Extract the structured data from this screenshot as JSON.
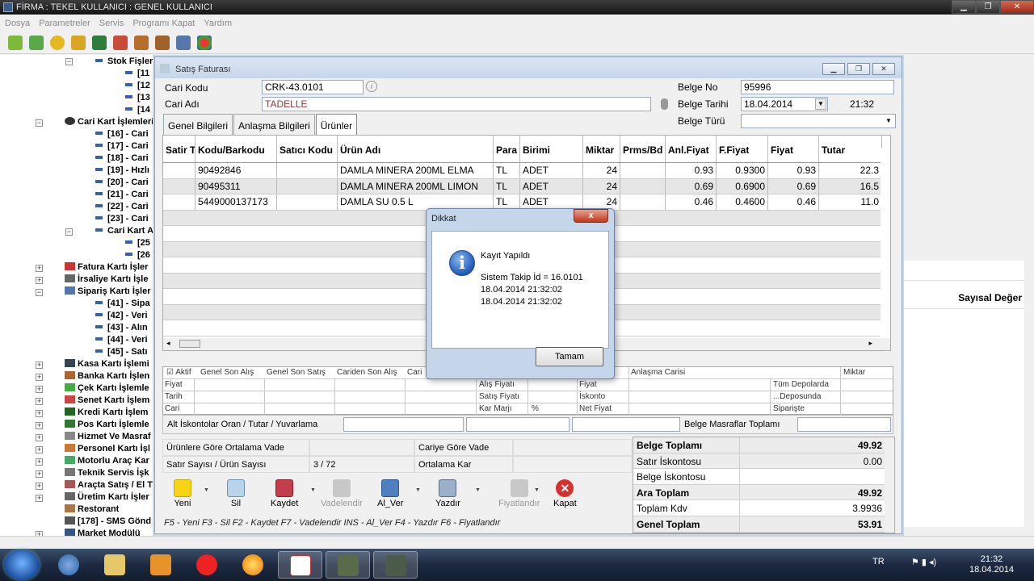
{
  "app_title": "FİRMA : TEKEL   KULLANICI : GENEL KULLANICI",
  "menu": [
    "Dosya",
    "Parametreler",
    "Servis",
    "Programı Kapat",
    "Yardım"
  ],
  "tree": {
    "stok_fisleri": "Stok Fişleri",
    "stok_children": [
      "[11",
      "[12",
      "[13",
      "[14"
    ],
    "cari_kart_islemleri": "Cari Kart İşlemleri",
    "cari_children": [
      "[16] - Cari",
      "[17] - Cari",
      "[18] - Cari",
      "[19] - Hızlı",
      "[20] - Cari",
      "[21] - Cari",
      "[22] - Cari",
      "[23] - Cari"
    ],
    "cari_kart_a": "Cari Kart A",
    "cari_a_children": [
      "[25",
      "[26"
    ],
    "fatura": "Fatura Kartı İşler",
    "irsaliye": "İrsaliye Kartı İşle",
    "siparis": "Sipariş Kartı İşler",
    "siparis_children": [
      "[41] - Sipa",
      "[42] - Veri",
      "[43] - Alın",
      "[44] - Veri",
      "[45] - Satı"
    ],
    "others": [
      "Kasa Kartı İşlemi",
      "Banka Kartı İşlen",
      "Çek Kartı İşlemle",
      "Senet Kartı İşlem",
      "Kredi Kartı İşlem",
      "Pos Kartı İşlemle",
      "Hizmet Ve Masraf",
      "Personel Kartı İşl",
      "Motorlu Araç Kar",
      "Teknik Servis İşk",
      "Araçta Satış / El T",
      "Üretim Kartı İşler",
      "Restorant",
      "[178] - SMS Gönd",
      "Market Modülü"
    ]
  },
  "right_pane": {
    "header": "Sayısal Değer"
  },
  "window": {
    "title": "Satış Faturası",
    "cari_kodu_label": "Cari Kodu",
    "cari_kodu": "CRK-43.0101",
    "cari_adi_label": "Cari  Adı",
    "cari_adi": "TADELLE",
    "belge_no_label": "Belge No",
    "belge_no": "95996",
    "belge_tarihi_label": "Belge Tarihi",
    "belge_tarihi": "18.04.2014",
    "time": "21:32",
    "belge_turu_label": "Belge Türü",
    "belge_turu": "",
    "tabs": [
      "Genel Bilgileri",
      "Anlaşma Bilgileri",
      "Ürünler"
    ]
  },
  "grid": {
    "columns": [
      "Satir T",
      "Kodu/Barkodu",
      "Satıcı Kodu",
      "Ürün Adı",
      "Para",
      "Birimi",
      "Miktar",
      "Prms/Bd",
      "Anl.Fiyat",
      "F.Fiyat",
      "Fiyat",
      "Tutar"
    ],
    "rows": [
      [
        "",
        "90492846",
        "",
        "DAMLA MINERA 200ML ELMA",
        "TL",
        "ADET",
        "24",
        "",
        "0.93",
        "0.9300",
        "0.93",
        "22.3"
      ],
      [
        "",
        "90495311",
        "",
        "DAMLA MINERA 200ML LIMON",
        "TL",
        "ADET",
        "24",
        "",
        "0.69",
        "0.6900",
        "0.69",
        "16.5"
      ],
      [
        "",
        "5449000137173",
        "",
        "DAMLA SU 0.5 L",
        "TL",
        "ADET",
        "24",
        "",
        "0.46",
        "0.4600",
        "0.46",
        "11.0"
      ]
    ]
  },
  "info_panel": {
    "aktif": "Aktif",
    "headers": [
      "Genel Son Alış",
      "Genel Son Satış",
      "Cariden Son Alış",
      "Cari"
    ],
    "row_labels": [
      "Fiyat",
      "Tarih",
      "Cari"
    ],
    "mid": [
      "Alış Fiyatı",
      "Satış Fiyatı",
      "Kar Marjı",
      "%"
    ],
    "mid2": [
      "Fiyat",
      "İskonto",
      "Net Fiyat"
    ],
    "anlasma_carisi": "Anlaşma Carisi",
    "miktar": "Miktar",
    "depots": [
      "Tüm Depolarda",
      "...Deposunda",
      "Siparişte"
    ]
  },
  "discount": {
    "label": "Alt İskontolar Oran / Tutar / Yuvarlama",
    "masraf": "Belge Masraflar Toplamı"
  },
  "summary": {
    "ortalama_vade": "Ürünlere Göre Ortalama Vade",
    "cari_vade": "Cariye Göre Vade",
    "satir_sayisi": "Satır Sayısı / Ürün Sayısı",
    "satir_value": "3 / 72",
    "ortalama_kar": "Ortalama Kar"
  },
  "buttons": [
    "Yeni",
    "Sil",
    "Kaydet",
    "Vadelendir",
    "Al_Ver",
    "Yazdır",
    "Fiyatlandır",
    "Kapat"
  ],
  "hint": "F5 - Yeni  F3 - Sil  F2 - Kaydet  F7 - Vadelendir  INS - Al_Ver  F4 - Yazdır  F6 - Fiyatlandır",
  "totals": [
    {
      "label": "Belge Toplamı",
      "value": "49.92"
    },
    {
      "label": "Satır İskontosu",
      "value": "0.00"
    },
    {
      "label": "Belge İskontosu",
      "value": ""
    },
    {
      "label": "Ara Toplam",
      "value": "49.92"
    },
    {
      "label": "Toplam Kdv",
      "value": "3.9936"
    },
    {
      "label": "Genel Toplam",
      "value": "53.91"
    }
  ],
  "dialog": {
    "title": "Dikkat",
    "close": "x",
    "message": "Kayıt Yapıldı",
    "line1": "Sistem Takip İd = 16.0101",
    "line2": "18.04.2014 21:32:02",
    "line3": "18.04.2014 21:32:02",
    "ok": "Tamam"
  },
  "taskbar": {
    "lang": "TR",
    "time": "21:32",
    "date": "18.04.2014"
  },
  "colors": {
    "accent": "#3862a8",
    "dialog_frame": "#c5d5ea",
    "alt_row": "#e6e6e6"
  }
}
